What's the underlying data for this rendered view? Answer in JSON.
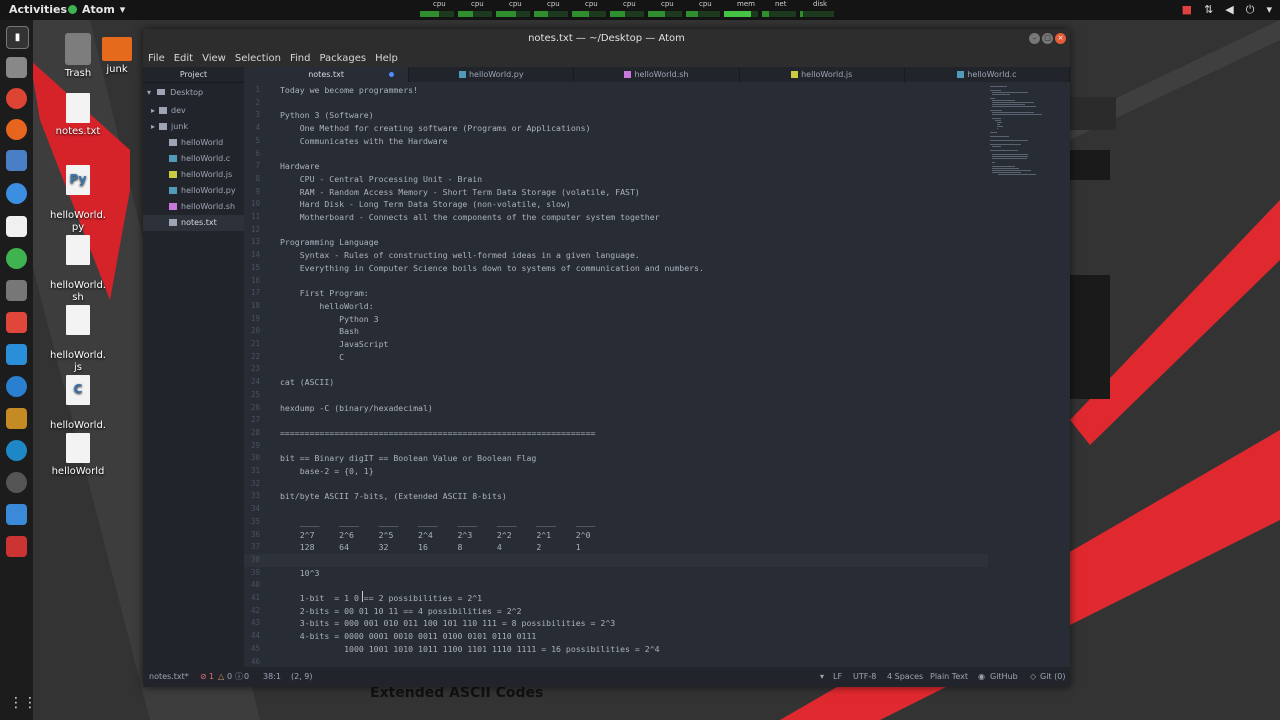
{
  "topbar": {
    "activities": "Activities",
    "app_name": "Atom",
    "monitors": [
      {
        "label": "cpu",
        "level": 0.55
      },
      {
        "label": "cpu",
        "level": 0.45
      },
      {
        "label": "cpu",
        "level": 0.6
      },
      {
        "label": "cpu",
        "level": 0.4
      },
      {
        "label": "cpu",
        "level": 0.5
      },
      {
        "label": "cpu",
        "level": 0.45
      },
      {
        "label": "cpu",
        "level": 0.5
      },
      {
        "label": "cpu",
        "level": 0.35
      },
      {
        "label": "mem",
        "level": 0.8
      },
      {
        "label": "net",
        "level": 0.2
      },
      {
        "label": "disk",
        "level": 0.1
      }
    ]
  },
  "desktop": {
    "icons": [
      {
        "label": "Trash"
      },
      {
        "label": "junk"
      },
      {
        "label": "notes.txt"
      },
      {
        "label": "helloWorld.\npy"
      },
      {
        "label": "helloWorld.\nsh"
      },
      {
        "label": "helloWorld.\njs"
      },
      {
        "label": "helloWorld.\nc"
      },
      {
        "label": "helloWorld"
      }
    ]
  },
  "window": {
    "title": "notes.txt — ~/Desktop — Atom",
    "menu": [
      "File",
      "Edit",
      "View",
      "Selection",
      "Find",
      "Packages",
      "Help"
    ]
  },
  "tree": {
    "header": "Project",
    "root": "Desktop",
    "items": [
      "dev",
      "junk",
      "helloWorld",
      "helloWorld.c",
      "helloWorld.js",
      "helloWorld.py",
      "helloWorld.sh",
      "notes.txt"
    ]
  },
  "tabs": [
    "notes.txt",
    "helloWorld.py",
    "helloWorld.sh",
    "helloWorld.js",
    "helloWorld.c"
  ],
  "editor": {
    "lines": [
      "Today we become programmers!",
      "",
      "Python 3 (Software)",
      "    One Method for creating software (Programs or Applications)",
      "    Communicates with the Hardware",
      "",
      "Hardware",
      "    CPU - Central Processing Unit - Brain",
      "    RAM - Random Access Memory - Short Term Data Storage (volatile, FAST)",
      "    Hard Disk - Long Term Data Storage (non-volatile, slow)",
      "    Motherboard - Connects all the components of the computer system together",
      "",
      "Programming Language",
      "    Syntax - Rules of constructing well-formed ideas in a given language.",
      "    Everything in Computer Science boils down to systems of communication and numbers.",
      "",
      "    First Program:",
      "        helloWorld:",
      "            Python 3",
      "            Bash",
      "            JavaScript",
      "            C",
      "",
      "cat (ASCII)",
      "",
      "hexdump -C (binary/hexadecimal)",
      "",
      "================================================================",
      "",
      "bit == Binary digIT == Boolean Value or Boolean Flag",
      "    base-2 = {0, 1}",
      "",
      "bit/byte ASCII 7-bits, (Extended ASCII 8-bits)",
      "",
      "    ____    ____    ____    ____    ____    ____    ____    ____",
      "    2^7     2^6     2^5     2^4     2^3     2^2     2^1     2^0",
      "    128     64      32      16      8       4       2       1",
      "",
      "    10^3",
      "",
      "    1-bit  = 1 0 == 2 possibilities = 2^1",
      "    2-bits = 00 01 10 11 == 4 possibilities = 2^2",
      "    3-bits = 000 001 010 011 100 101 110 111 = 8 possibilities = 2^3",
      "    4-bits = 0000 0001 0010 0011 0100 0101 0110 0111",
      "             1000 1001 1010 1011 1100 1101 1110 1111 = 16 possibilities = 2^4",
      ""
    ],
    "current_line": 38
  },
  "status": {
    "file": "notes.txt*",
    "errors": "1",
    "warnings": "0",
    "infos": "0",
    "cursor": "38:1",
    "selection": "(2, 9)",
    "line_ending": "LF",
    "encoding": "UTF-8",
    "indent": "4 Spaces",
    "grammar": "Plain Text",
    "github": "GitHub",
    "git": "Git (0)"
  },
  "overlay_text": "Extended ASCII Codes"
}
